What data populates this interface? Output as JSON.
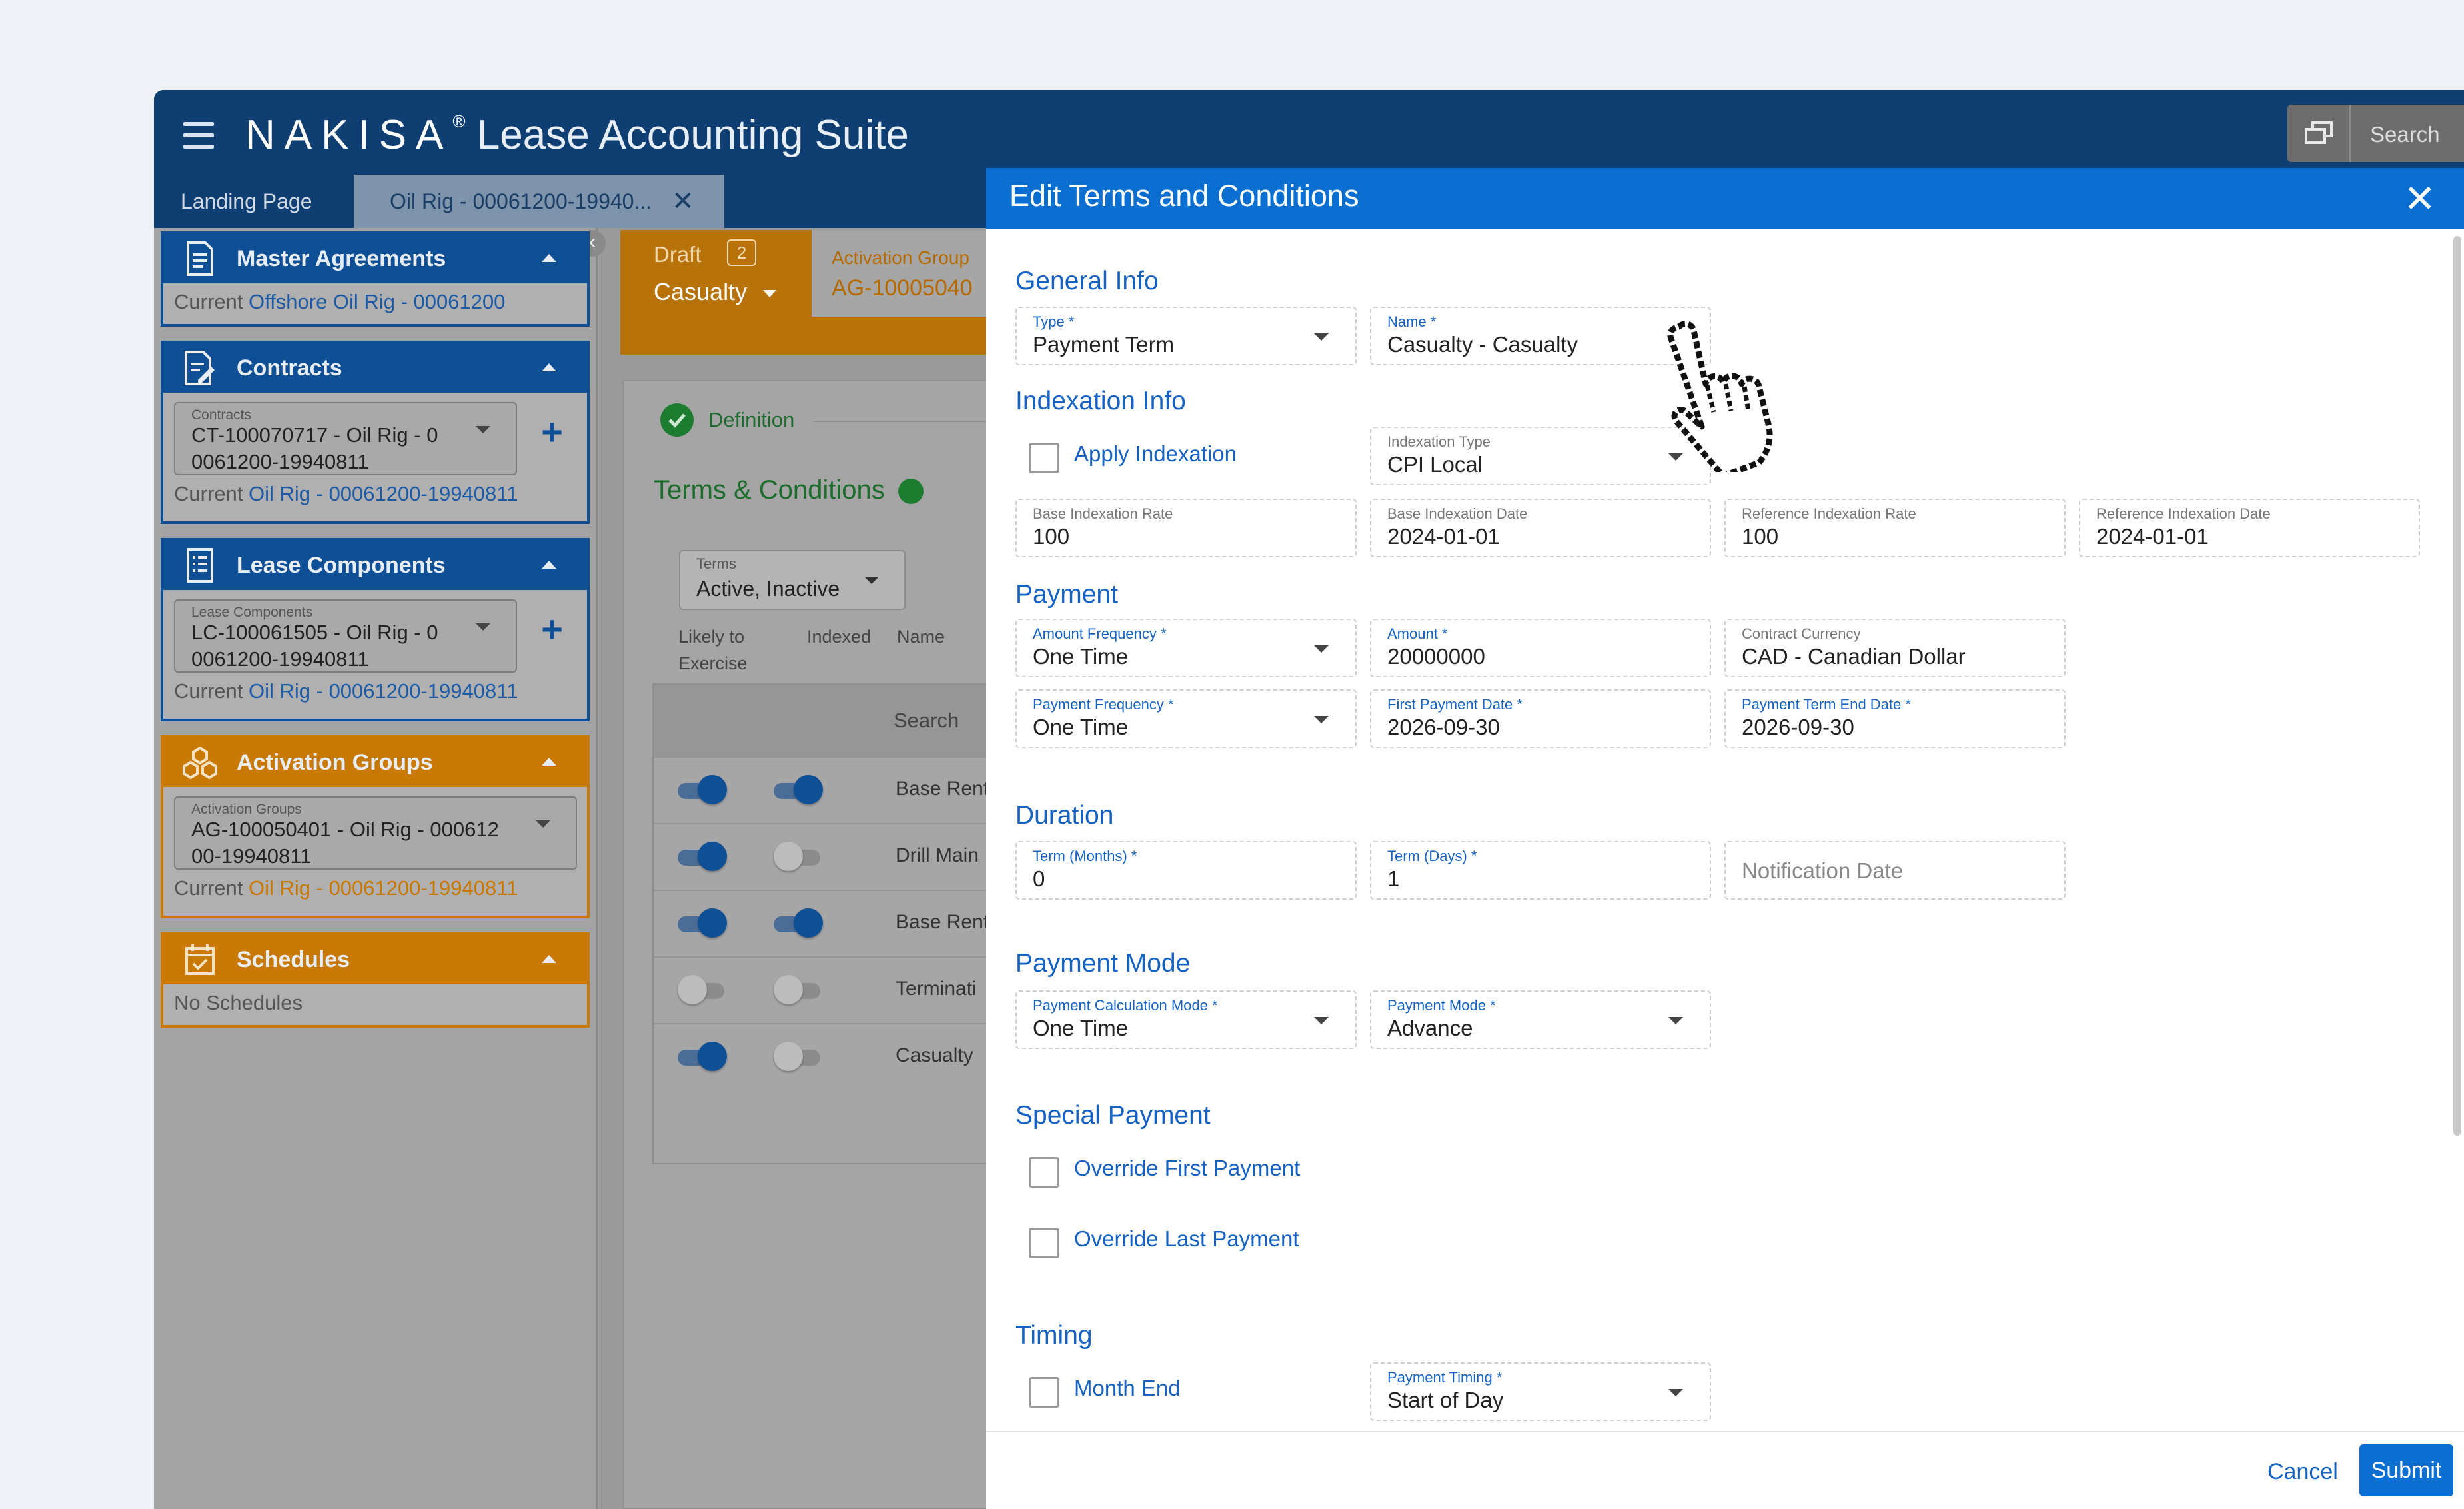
{
  "app": {
    "brand_logo": "NAKISA",
    "brand_reg": "®",
    "suite": "Lease Accounting Suite",
    "search_label": "Search"
  },
  "tabs": [
    {
      "label": "Landing Page"
    },
    {
      "label": "Oil Rig - 00061200-19940...",
      "close": "✕"
    }
  ],
  "sidebar": {
    "master": {
      "title": "Master Agreements",
      "current_prefix": "Current",
      "current_value": "Offshore Oil Rig - 00061200"
    },
    "contracts": {
      "title": "Contracts",
      "field_label": "Contracts",
      "field_value": "CT-100070717 - Oil Rig - 0 0061200-19940811",
      "add": "+",
      "current_prefix": "Current",
      "current_value": "Oil Rig - 00061200-19940811"
    },
    "lease": {
      "title": "Lease Components",
      "field_label": "Lease Components",
      "field_value": "LC-100061505 - Oil Rig - 0 0061200-19940811",
      "add": "+",
      "current_prefix": "Current",
      "current_value": "Oil Rig - 00061200-19940811"
    },
    "activation": {
      "title": "Activation Groups",
      "field_label": "Activation Groups",
      "field_value": "AG-100050401 - Oil Rig - 000612 00-19940811",
      "current_prefix": "Current",
      "current_value": "Oil Rig - 00061200-19940811"
    },
    "schedules": {
      "title": "Schedules",
      "empty": "No Schedules"
    },
    "collapse": "‹"
  },
  "middle": {
    "draft_label": "Draft",
    "draft_count": "2",
    "draft_type": "Casualty",
    "ag_label": "Activation Group",
    "ag_value": "AG-10005040",
    "definition": "Definition",
    "terms_conditions": "Terms & Conditions",
    "terms_filter": {
      "label": "Terms",
      "value": "Active, Inactive"
    },
    "columns": {
      "likely": "Likely to Exercise",
      "indexed": "Indexed",
      "name": "Name"
    },
    "search": "Search",
    "rows": [
      {
        "likely": true,
        "indexed": true,
        "name": "Base Rent"
      },
      {
        "likely": true,
        "indexed": false,
        "name": "Drill Main"
      },
      {
        "likely": true,
        "indexed": true,
        "name": "Base Rent"
      },
      {
        "likely": false,
        "indexed": false,
        "name": "Terminati"
      },
      {
        "likely": true,
        "indexed": false,
        "name": "Casualty"
      }
    ]
  },
  "modal": {
    "title": "Edit Terms and Conditions",
    "close": "✕",
    "general": {
      "heading": "General Info",
      "type": {
        "label": "Type *",
        "value": "Payment Term"
      },
      "name": {
        "label": "Name *",
        "value": "Casualty - Casualty"
      }
    },
    "indexation": {
      "heading": "Indexation Info",
      "apply": "Apply Indexation",
      "apply_checked": false,
      "type": {
        "label": "Indexation Type",
        "value": "CPI Local"
      },
      "base_rate": {
        "label": "Base Indexation Rate",
        "value": "100"
      },
      "base_date": {
        "label": "Base Indexation Date",
        "value": "2024-01-01"
      },
      "ref_rate": {
        "label": "Reference Indexation Rate",
        "value": "100"
      },
      "ref_date": {
        "label": "Reference Indexation Date",
        "value": "2024-01-01"
      }
    },
    "payment": {
      "heading": "Payment",
      "amount_frequency": {
        "label": "Amount Frequency *",
        "value": "One Time"
      },
      "amount": {
        "label": "Amount *",
        "value": "20000000"
      },
      "currency": {
        "label": "Contract Currency",
        "value": "CAD - Canadian Dollar"
      },
      "payment_frequency": {
        "label": "Payment Frequency *",
        "value": "One Time"
      },
      "first_date": {
        "label": "First Payment Date *",
        "value": "2026-09-30"
      },
      "end_date": {
        "label": "Payment Term End Date *",
        "value": "2026-09-30"
      }
    },
    "duration": {
      "heading": "Duration",
      "months": {
        "label": "Term (Months) *",
        "value": "0"
      },
      "days": {
        "label": "Term (Days) *",
        "value": "1"
      },
      "notification": {
        "placeholder": "Notification Date"
      }
    },
    "mode": {
      "heading": "Payment Mode",
      "calc": {
        "label": "Payment Calculation Mode *",
        "value": "One Time"
      },
      "mode": {
        "label": "Payment Mode *",
        "value": "Advance"
      }
    },
    "special": {
      "heading": "Special Payment",
      "first": "Override First Payment",
      "last": "Override Last Payment"
    },
    "timing": {
      "heading": "Timing",
      "month_end": "Month End",
      "payment_timing": {
        "label": "Payment Timing *",
        "value": "Start of Day"
      }
    },
    "footer": {
      "cancel": "Cancel",
      "submit": "Submit"
    }
  },
  "colors": {
    "header": "#0f3e72",
    "modal_header": "#0a6fd0",
    "accent": "#1562c2",
    "orange": "#c97a06"
  }
}
